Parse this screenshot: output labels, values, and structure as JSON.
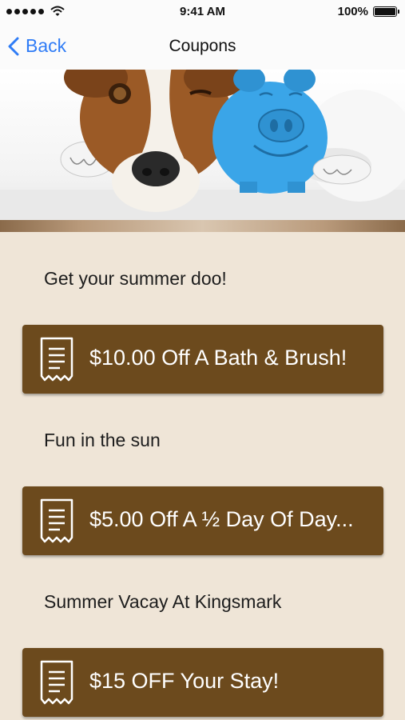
{
  "status": {
    "time": "9:41 AM",
    "battery": "100%",
    "battery_level": 1.0
  },
  "nav": {
    "back_label": "Back",
    "title": "Coupons"
  },
  "coupons": [
    {
      "label": "Get your summer doo!",
      "title": "$10.00 Off A Bath & Brush!"
    },
    {
      "label": "Fun in the sun",
      "title": "$5.00 Off A ½ Day Of Day..."
    },
    {
      "label": "Summer Vacay At Kingsmark",
      "title": "$15 OFF Your Stay!"
    }
  ],
  "colors": {
    "accent": "#2f7cf6",
    "coupon_bg": "#6c4a1d",
    "page_bg": "#efe5d7"
  }
}
